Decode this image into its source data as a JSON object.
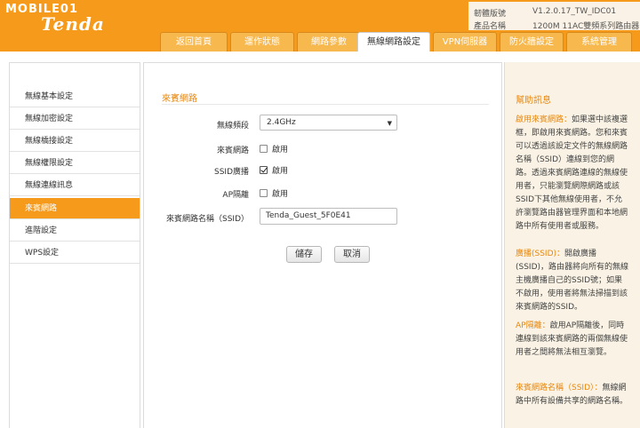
{
  "colors": {
    "brand_orange": "#f59a1b",
    "accent_text": "#e8870e",
    "help_bg": "#faf3e5"
  },
  "header": {
    "logo_top": "MOBILE01",
    "logo_bottom": "Tenda",
    "firmware_label": "韌體版號",
    "firmware_value": "V1.2.0.17_TW_IDC01",
    "product_label": "產品名稱",
    "product_value": "1200M 11AC雙頻系列路由器"
  },
  "tabs": [
    {
      "label": "返回首頁",
      "active": false
    },
    {
      "label": "運作狀態",
      "active": false
    },
    {
      "label": "網路參數",
      "active": false
    },
    {
      "label": "無線網路設定",
      "active": true
    },
    {
      "label": "VPN伺服器",
      "active": false
    },
    {
      "label": "防火牆設定",
      "active": false
    },
    {
      "label": "系統管理",
      "active": false
    }
  ],
  "sidebar": {
    "items": [
      {
        "label": "無線基本設定",
        "active": false
      },
      {
        "label": "無線加密設定",
        "active": false
      },
      {
        "label": "無線橋接設定",
        "active": false
      },
      {
        "label": "無線權限設定",
        "active": false
      },
      {
        "label": "無線連線訊息",
        "active": false
      },
      {
        "label": "來賓網路",
        "active": true
      },
      {
        "label": "進階設定",
        "active": false
      },
      {
        "label": "WPS設定",
        "active": false
      }
    ]
  },
  "main": {
    "section_title": "來賓網路",
    "band_label": "無線頻段",
    "band_value": "2.4GHz",
    "guest_label": "來賓網路",
    "guest_option": "啟用",
    "guest_checked": false,
    "ssid_broadcast_label": "SSID廣播",
    "ssid_broadcast_option": "啟用",
    "ssid_broadcast_checked": true,
    "ap_isolation_label": "AP隔離",
    "ap_isolation_option": "啟用",
    "ap_isolation_checked": false,
    "ssid_name_label": "來賓網路名稱（SSID）",
    "ssid_name_value": "Tenda_Guest_5F0E41",
    "save_label": "儲存",
    "cancel_label": "取消"
  },
  "help": {
    "title": "幫助訊息",
    "p1_term": "啟用來賓網路：",
    "p1_text": "如果選中該複選框，即啟用來賓網路。您和來賓可以透過該設定文件的無線網路名稱（SSID）連線到您的網路。透過來賓網路連線的無線使用者，只能瀏覽網際網路或該SSID下其他無線使用者，不允許瀏覽路由器管理界面和本地網路中所有使用者或服務。",
    "p2_term": "廣播(SSID)：",
    "p2_text": "開啟廣播(SSID)，路由器將向所有的無線主機廣播自己的SSID號；如果不啟用，使用者將無法掃描到該來賓網路的SSID。",
    "p3_term": "AP隔離：",
    "p3_text": "啟用AP隔離後，同時連線到該來賓網路的兩個無線使用者之間將無法相互瀏覽。",
    "p4_term": "來賓網路名稱（SSID）：",
    "p4_text": "無線網路中所有設備共享的網路名稱。"
  }
}
